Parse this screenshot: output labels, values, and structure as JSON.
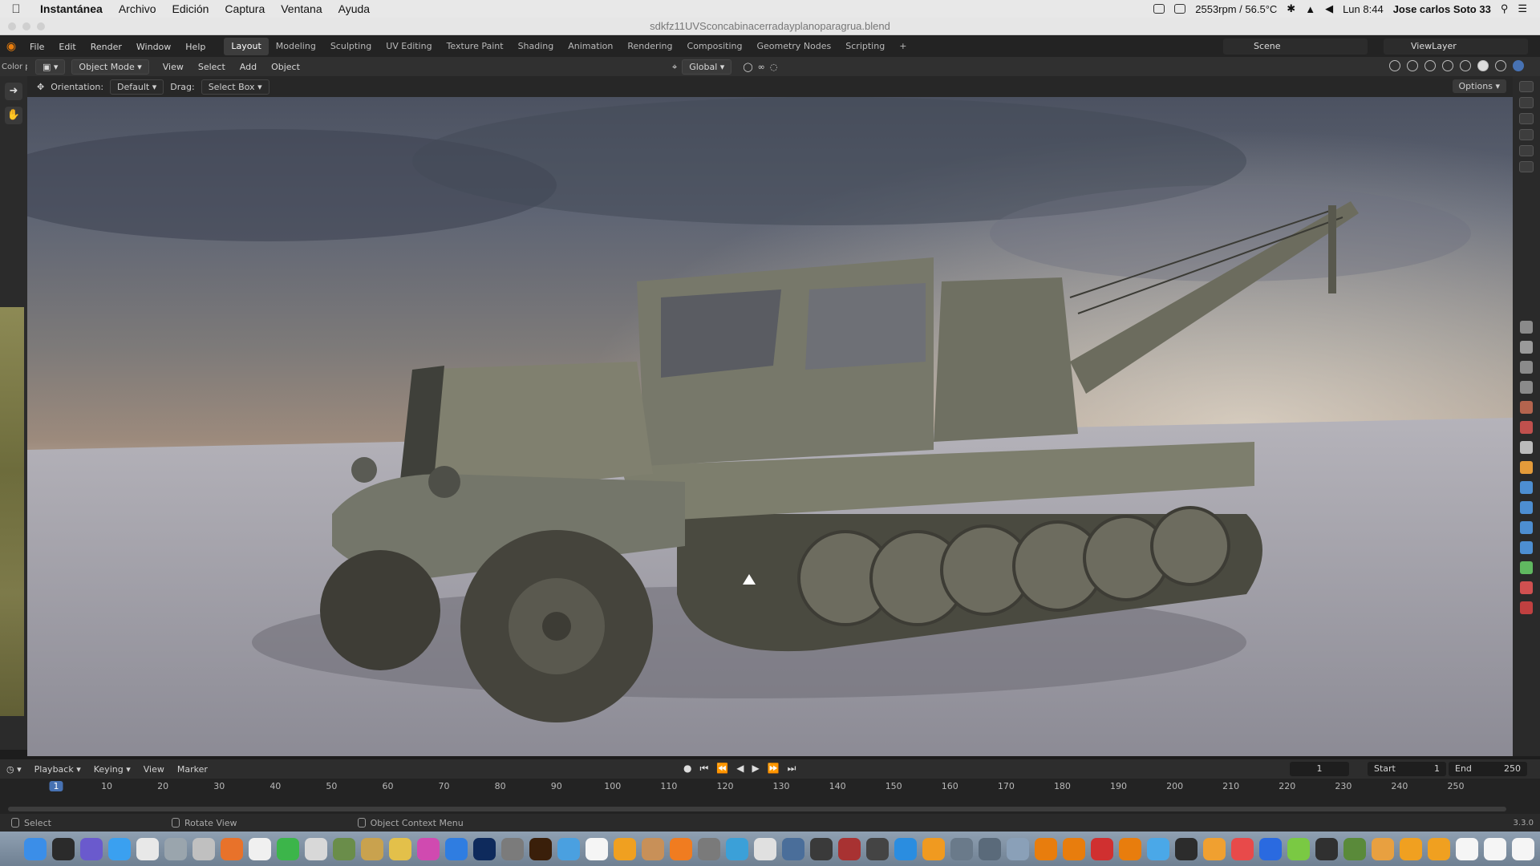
{
  "mac_menubar": {
    "app_name": "Instantánea",
    "items": [
      "Archivo",
      "Edición",
      "Captura",
      "Ventana",
      "Ayuda"
    ],
    "fan_temp": "2553rpm / 56.5°C",
    "clock": "Lun 8:44",
    "user": "Jose carlos Soto 33"
  },
  "window": {
    "title": "sdkfz11UVSconcabinacerradayplanoparagrua.blend"
  },
  "blender": {
    "menus": [
      "File",
      "Edit",
      "Render",
      "Window",
      "Help"
    ],
    "workspaces": [
      "Layout",
      "Modeling",
      "Sculpting",
      "UV Editing",
      "Texture Paint",
      "Shading",
      "Animation",
      "Rendering",
      "Compositing",
      "Geometry Nodes",
      "Scripting"
    ],
    "active_workspace": "Layout",
    "scene": "Scene",
    "view_layer": "ViewLayer"
  },
  "header": {
    "left_label": "Color p",
    "mode": "Object Mode",
    "menus": [
      "View",
      "Select",
      "Add",
      "Object"
    ],
    "transform_orientation": "Global"
  },
  "tool_settings": {
    "orientation_label": "Orientation:",
    "orientation_value": "Default",
    "drag_label": "Drag:",
    "drag_value": "Select Box",
    "options": "Options"
  },
  "timeline": {
    "menus": [
      "Playback",
      "Keying",
      "View",
      "Marker"
    ],
    "current_frame": "1",
    "start_label": "Start",
    "start_value": "1",
    "end_label": "End",
    "end_value": "250",
    "ruler": [
      "1",
      "10",
      "20",
      "30",
      "40",
      "50",
      "60",
      "70",
      "80",
      "90",
      "100",
      "110",
      "120",
      "130",
      "140",
      "150",
      "160",
      "170",
      "180",
      "190",
      "200",
      "210",
      "220",
      "230",
      "240",
      "250"
    ]
  },
  "statusbar": {
    "select": "Select",
    "rotate": "Rotate View",
    "context": "Object Context Menu",
    "version": "3.3.0"
  },
  "colors": {
    "accent": "#4772b3",
    "blender_orange": "#e87d0d"
  }
}
